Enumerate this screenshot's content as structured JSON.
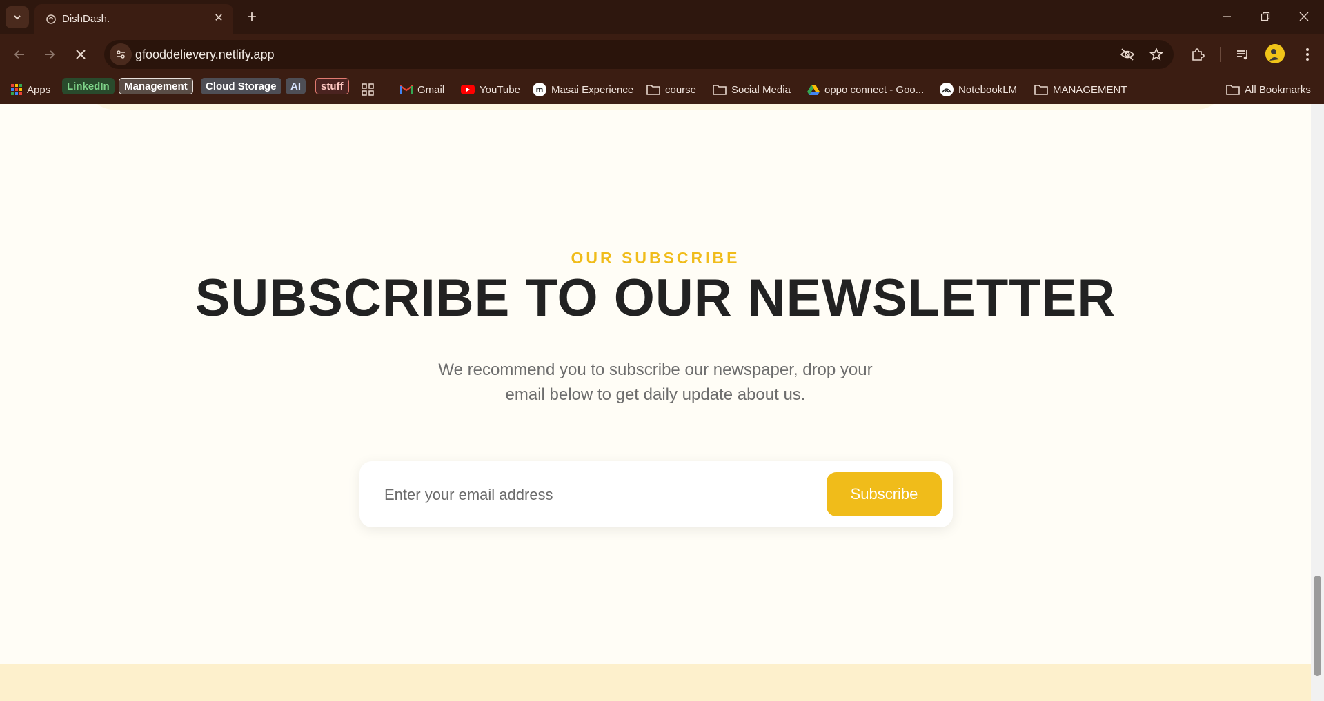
{
  "browser": {
    "tab_title": "DishDash.",
    "url": "gfooddelievery.netlify.app",
    "bookmarks": {
      "apps": "Apps",
      "linkedin": "LinkedIn",
      "management": "Management",
      "cloud_storage": "Cloud Storage",
      "ai": "AI",
      "stuff": "stuff",
      "gmail": "Gmail",
      "youtube": "YouTube",
      "masai": "Masai Experience",
      "course": "course",
      "social_media": "Social Media",
      "oppo": "oppo connect - Goo...",
      "notebooklm": "NotebookLM",
      "management_folder": "MANAGEMENT",
      "all_bookmarks": "All Bookmarks"
    },
    "colors": {
      "chrome": "#3b1d12",
      "tabstrip": "#2e170e"
    }
  },
  "newsletter": {
    "eyebrow": "OUR SUBSCRIBE",
    "title": "SUBSCRIBE TO OUR NEWSLETTER",
    "description": "We recommend you to subscribe our newspaper, drop your email below to get daily update about us.",
    "email_placeholder": "Enter your email address",
    "email_value": "",
    "button_label": "Subscribe",
    "accent_color": "#f0bc1a"
  }
}
